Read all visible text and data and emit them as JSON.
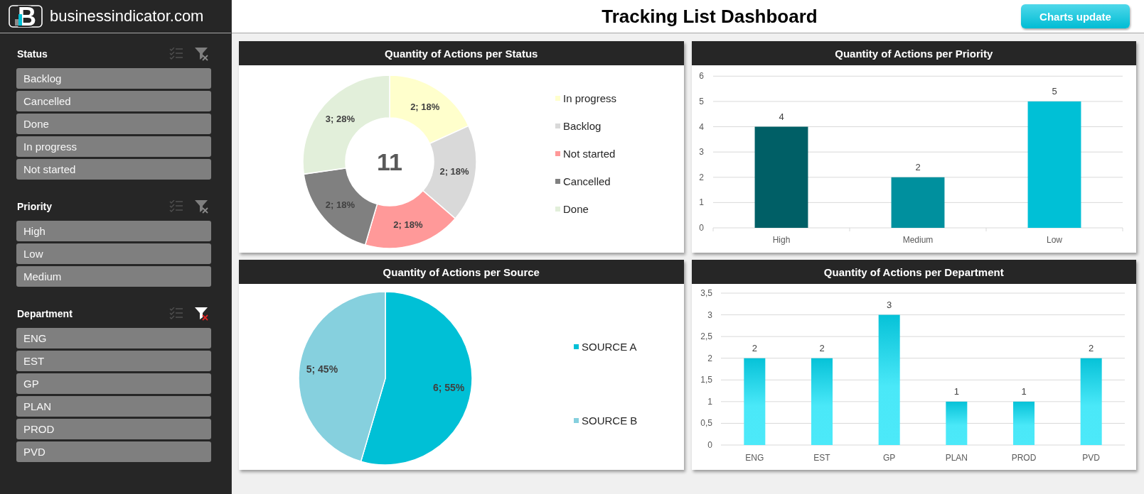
{
  "sidebar": {
    "logo_letter": "B",
    "brand": "businessindicator.com",
    "filters": [
      {
        "title": "Status",
        "clear_filter_active": false,
        "items": [
          {
            "label": "Backlog",
            "selected": true
          },
          {
            "label": "Cancelled",
            "selected": true
          },
          {
            "label": "Done",
            "selected": true
          },
          {
            "label": "In progress",
            "selected": true
          },
          {
            "label": "Not started",
            "selected": true
          }
        ]
      },
      {
        "title": "Priority",
        "clear_filter_active": false,
        "items": [
          {
            "label": "High",
            "selected": true
          },
          {
            "label": "Low",
            "selected": true
          },
          {
            "label": "Medium",
            "selected": true
          }
        ]
      },
      {
        "title": "Department",
        "clear_filter_active": true,
        "items": [
          {
            "label": "ENG",
            "selected": true
          },
          {
            "label": "EST",
            "selected": true
          },
          {
            "label": "GP",
            "selected": true
          },
          {
            "label": "PLAN",
            "selected": true
          },
          {
            "label": "PROD",
            "selected": true
          },
          {
            "label": "PVD",
            "selected": true
          }
        ]
      }
    ]
  },
  "header": {
    "title": "Tracking List Dashboard",
    "button": "Charts update"
  },
  "charts": [
    {
      "title": "Quantity of Actions per Status",
      "center_label": "11",
      "chart_data": {
        "type": "donut",
        "categories": [
          "In progress",
          "Backlog",
          "Not started",
          "Cancelled",
          "Done"
        ],
        "values": [
          2,
          2,
          2,
          2,
          3
        ],
        "colors": [
          "#ffffcc",
          "#d9d9d9",
          "#ff9999",
          "#808080",
          "#e2efda"
        ],
        "value_labels": [
          "2; 18%",
          "2; 18%",
          "2; 18%",
          "2; 18%",
          "3; 28%"
        ],
        "legend": "right"
      }
    },
    {
      "title": "Quantity of Actions per Priority",
      "chart_data": {
        "type": "bar",
        "categories": [
          "High",
          "Medium",
          "Low"
        ],
        "values": [
          4,
          2,
          5
        ],
        "colors": [
          "#005f66",
          "#00909e",
          "#00c0d6"
        ],
        "ylim": [
          0,
          6
        ],
        "yticks": [
          0,
          1,
          2,
          3,
          4,
          5,
          6
        ],
        "data_labels": true,
        "grid": true
      }
    },
    {
      "title": "Quantity of Actions per Source",
      "chart_data": {
        "type": "pie",
        "categories": [
          "SOURCE A",
          "SOURCE B"
        ],
        "values": [
          6,
          5
        ],
        "colors": [
          "#00c0d6",
          "#86d0de"
        ],
        "value_labels": [
          "6; 55%",
          "5; 45%"
        ],
        "legend": "right"
      }
    },
    {
      "title": "Quantity of Actions per Department",
      "chart_data": {
        "type": "bar",
        "categories": [
          "ENG",
          "EST",
          "GP",
          "PLAN",
          "PROD",
          "PVD"
        ],
        "values": [
          2,
          2,
          3,
          1,
          1,
          2
        ],
        "ylim": [
          0,
          3.5
        ],
        "yticks": [
          0,
          {
            "value": 0.5,
            "label": "0,5"
          },
          1,
          {
            "value": 1.5,
            "label": "1,5"
          },
          2,
          {
            "value": 2.5,
            "label": "2,5"
          },
          3,
          {
            "value": 3.5,
            "label": "3,5"
          }
        ],
        "data_labels": true,
        "grid": true
      }
    }
  ]
}
